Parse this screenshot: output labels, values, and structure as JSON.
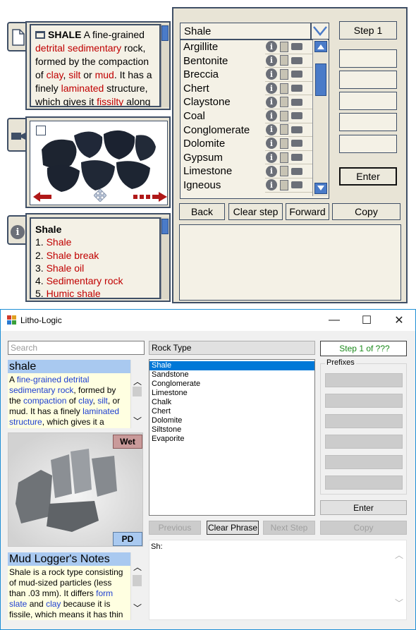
{
  "mockup": {
    "definition": {
      "term": "SHALE",
      "text_parts": [
        {
          "t": " A fine-grained ",
          "link": false
        },
        {
          "t": "detrital sedimentary",
          "link": true
        },
        {
          "t": " rock, formed by the compaction of ",
          "link": false
        },
        {
          "t": "clay",
          "link": true
        },
        {
          "t": ", ",
          "link": false
        },
        {
          "t": "silt",
          "link": true
        },
        {
          "t": " or ",
          "link": false
        },
        {
          "t": "mud",
          "link": true
        },
        {
          "t": ". It has a finely ",
          "link": false
        },
        {
          "t": "laminated",
          "link": true
        },
        {
          "t": " structure, which gives it ",
          "link": false
        },
        {
          "t": "fissilty",
          "link": true
        },
        {
          "t": " along",
          "link": false
        }
      ]
    },
    "search_value": "Shale",
    "rock_types": [
      "Argillite",
      "Bentonite",
      "Breccia",
      "Chert",
      "Claystone",
      "Coal",
      "Conglomerate",
      "Dolomite",
      "Gypsum",
      "Limestone",
      "Igneous"
    ],
    "step_label": "Step 1",
    "enter_label": "Enter",
    "nav": {
      "back": "Back",
      "clear": "Clear step",
      "forward": "Forward",
      "copy": "Copy"
    },
    "related": {
      "title": "Shale",
      "items": [
        "1. Shale",
        "2. Shale break",
        "3. Shale oil",
        "4. Sedimentary rock",
        "5. Humic shale"
      ]
    },
    "icons": [
      "info-icon",
      "document-icon",
      "camera-icon"
    ]
  },
  "window": {
    "title": "Litho-Logic",
    "controls": {
      "minimize": "—",
      "maximize": "☐",
      "close": "✕"
    },
    "search_placeholder": "Search",
    "rock_type_label": "Rock Type",
    "step_text": "Step 1 of ???",
    "definition": {
      "header": "shale",
      "parts": [
        {
          "t": "A ",
          "link": false
        },
        {
          "t": "fine-grained detrital sedimentary rock",
          "link": true
        },
        {
          "t": ", formed by the ",
          "link": false
        },
        {
          "t": "compaction",
          "link": true
        },
        {
          "t": " of ",
          "link": false
        },
        {
          "t": "clay",
          "link": true
        },
        {
          "t": ", ",
          "link": false
        },
        {
          "t": "silt",
          "link": true
        },
        {
          "t": ", or mud. It has a finely ",
          "link": false
        },
        {
          "t": "laminated structure",
          "link": true
        },
        {
          "t": ", which gives it a",
          "link": false
        }
      ]
    },
    "photo_labels": {
      "wet": "Wet",
      "pd": "PD"
    },
    "notes": {
      "header": "Mud Logger's Notes",
      "parts": [
        {
          "t": "Shale is a rock type consisting of mud-sized particles (less than .03 mm). It differs ",
          "link": false
        },
        {
          "t": "form slate",
          "link": true
        },
        {
          "t": " and ",
          "link": false
        },
        {
          "t": "clay",
          "link": true
        },
        {
          "t": " because it is fissile, which means it has thin",
          "link": false
        }
      ]
    },
    "rock_list": [
      "Shale",
      "Sandstone",
      "Conglomerate",
      "Limestone",
      "Chalk",
      "Chert",
      "Dolomite",
      "Siltstone",
      "Evaporite"
    ],
    "selected_rock": "Shale",
    "buttons": {
      "previous": "Previous",
      "clear_phrase": "Clear Phrase",
      "next_step": "Next Step",
      "enter": "Enter",
      "copy": "Copy"
    },
    "prefixes_label": "Prefixes",
    "output_text": "Sh:",
    "colors": {
      "link_blue": "#1e3fd0",
      "step_green": "#1a8a1a",
      "header_blue": "#a9c9f0",
      "wet_badge": "#c99a9a",
      "pd_badge": "#a9c9f0"
    }
  }
}
